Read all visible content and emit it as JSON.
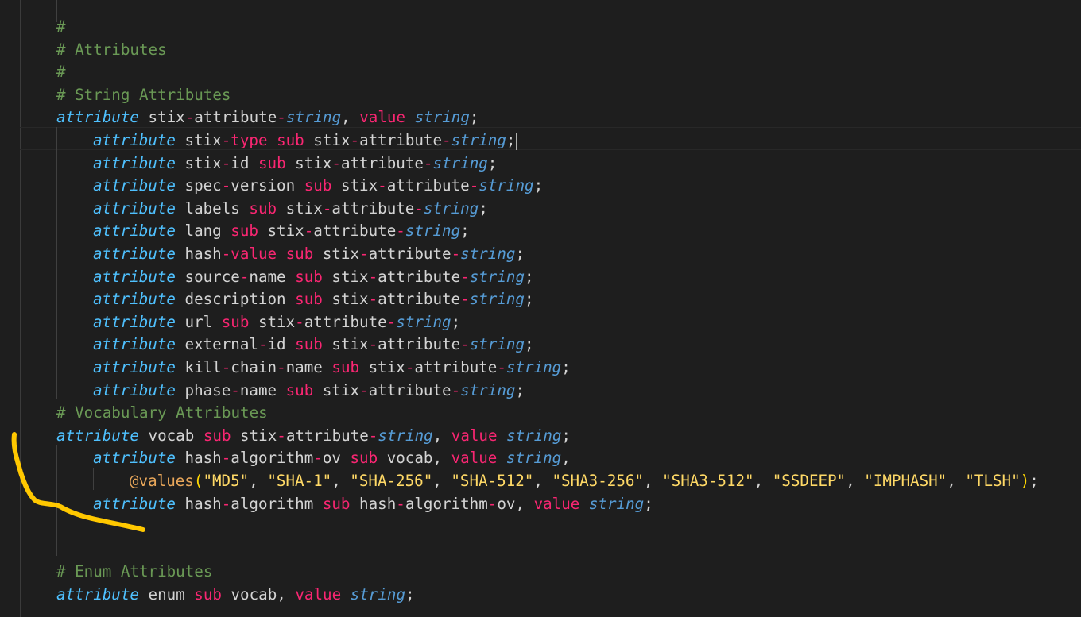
{
  "lines": [
    {
      "indent": 0,
      "tokens": [
        {
          "t": "#",
          "c": "cm"
        }
      ]
    },
    {
      "indent": 0,
      "tokens": [
        {
          "t": "# Attributes",
          "c": "cm"
        }
      ]
    },
    {
      "indent": 0,
      "tokens": [
        {
          "t": "#",
          "c": "cm"
        }
      ]
    },
    {
      "indent": 0,
      "tokens": [
        {
          "t": "# String Attributes",
          "c": "cm"
        }
      ]
    },
    {
      "indent": 0,
      "tokens": [
        {
          "t": "attribute",
          "c": "kw"
        },
        {
          "t": " stix",
          "c": "tx"
        },
        {
          "t": "-",
          "c": "pk"
        },
        {
          "t": "attribute",
          "c": "tx"
        },
        {
          "t": "-",
          "c": "pk"
        },
        {
          "t": "string",
          "c": "ty"
        },
        {
          "t": ", ",
          "c": "tx"
        },
        {
          "t": "value",
          "c": "pk"
        },
        {
          "t": " ",
          "c": "tx"
        },
        {
          "t": "string",
          "c": "ty"
        },
        {
          "t": ";",
          "c": "tx"
        }
      ]
    },
    {
      "indent": 1,
      "cursor": true,
      "tokens": [
        {
          "t": "attribute",
          "c": "kw"
        },
        {
          "t": " stix",
          "c": "tx"
        },
        {
          "t": "-",
          "c": "pk"
        },
        {
          "t": "type",
          "c": "pk"
        },
        {
          "t": " ",
          "c": "tx"
        },
        {
          "t": "sub",
          "c": "pk"
        },
        {
          "t": " stix",
          "c": "tx"
        },
        {
          "t": "-",
          "c": "pk"
        },
        {
          "t": "attribute",
          "c": "tx"
        },
        {
          "t": "-",
          "c": "pk"
        },
        {
          "t": "string",
          "c": "ty"
        },
        {
          "t": ";",
          "c": "tx"
        }
      ]
    },
    {
      "indent": 1,
      "tokens": [
        {
          "t": "attribute",
          "c": "kw"
        },
        {
          "t": " stix",
          "c": "tx"
        },
        {
          "t": "-",
          "c": "pk"
        },
        {
          "t": "id",
          "c": "tx"
        },
        {
          "t": " ",
          "c": "tx"
        },
        {
          "t": "sub",
          "c": "pk"
        },
        {
          "t": " stix",
          "c": "tx"
        },
        {
          "t": "-",
          "c": "pk"
        },
        {
          "t": "attribute",
          "c": "tx"
        },
        {
          "t": "-",
          "c": "pk"
        },
        {
          "t": "string",
          "c": "ty"
        },
        {
          "t": ";",
          "c": "tx"
        }
      ]
    },
    {
      "indent": 1,
      "tokens": [
        {
          "t": "attribute",
          "c": "kw"
        },
        {
          "t": " spec",
          "c": "tx"
        },
        {
          "t": "-",
          "c": "pk"
        },
        {
          "t": "version",
          "c": "tx"
        },
        {
          "t": " ",
          "c": "tx"
        },
        {
          "t": "sub",
          "c": "pk"
        },
        {
          "t": " stix",
          "c": "tx"
        },
        {
          "t": "-",
          "c": "pk"
        },
        {
          "t": "attribute",
          "c": "tx"
        },
        {
          "t": "-",
          "c": "pk"
        },
        {
          "t": "string",
          "c": "ty"
        },
        {
          "t": ";",
          "c": "tx"
        }
      ]
    },
    {
      "indent": 1,
      "tokens": [
        {
          "t": "attribute",
          "c": "kw"
        },
        {
          "t": " labels",
          "c": "tx"
        },
        {
          "t": " ",
          "c": "tx"
        },
        {
          "t": "sub",
          "c": "pk"
        },
        {
          "t": " stix",
          "c": "tx"
        },
        {
          "t": "-",
          "c": "pk"
        },
        {
          "t": "attribute",
          "c": "tx"
        },
        {
          "t": "-",
          "c": "pk"
        },
        {
          "t": "string",
          "c": "ty"
        },
        {
          "t": ";",
          "c": "tx"
        }
      ]
    },
    {
      "indent": 1,
      "tokens": [
        {
          "t": "attribute",
          "c": "kw"
        },
        {
          "t": " lang",
          "c": "tx"
        },
        {
          "t": " ",
          "c": "tx"
        },
        {
          "t": "sub",
          "c": "pk"
        },
        {
          "t": " stix",
          "c": "tx"
        },
        {
          "t": "-",
          "c": "pk"
        },
        {
          "t": "attribute",
          "c": "tx"
        },
        {
          "t": "-",
          "c": "pk"
        },
        {
          "t": "string",
          "c": "ty"
        },
        {
          "t": ";",
          "c": "tx"
        }
      ]
    },
    {
      "indent": 1,
      "tokens": [
        {
          "t": "attribute",
          "c": "kw"
        },
        {
          "t": " hash",
          "c": "tx"
        },
        {
          "t": "-",
          "c": "pk"
        },
        {
          "t": "value",
          "c": "pk"
        },
        {
          "t": " ",
          "c": "tx"
        },
        {
          "t": "sub",
          "c": "pk"
        },
        {
          "t": " stix",
          "c": "tx"
        },
        {
          "t": "-",
          "c": "pk"
        },
        {
          "t": "attribute",
          "c": "tx"
        },
        {
          "t": "-",
          "c": "pk"
        },
        {
          "t": "string",
          "c": "ty"
        },
        {
          "t": ";",
          "c": "tx"
        }
      ]
    },
    {
      "indent": 1,
      "tokens": [
        {
          "t": "attribute",
          "c": "kw"
        },
        {
          "t": " source",
          "c": "tx"
        },
        {
          "t": "-",
          "c": "pk"
        },
        {
          "t": "name",
          "c": "tx"
        },
        {
          "t": " ",
          "c": "tx"
        },
        {
          "t": "sub",
          "c": "pk"
        },
        {
          "t": " stix",
          "c": "tx"
        },
        {
          "t": "-",
          "c": "pk"
        },
        {
          "t": "attribute",
          "c": "tx"
        },
        {
          "t": "-",
          "c": "pk"
        },
        {
          "t": "string",
          "c": "ty"
        },
        {
          "t": ";",
          "c": "tx"
        }
      ]
    },
    {
      "indent": 1,
      "tokens": [
        {
          "t": "attribute",
          "c": "kw"
        },
        {
          "t": " description",
          "c": "tx"
        },
        {
          "t": " ",
          "c": "tx"
        },
        {
          "t": "sub",
          "c": "pk"
        },
        {
          "t": " stix",
          "c": "tx"
        },
        {
          "t": "-",
          "c": "pk"
        },
        {
          "t": "attribute",
          "c": "tx"
        },
        {
          "t": "-",
          "c": "pk"
        },
        {
          "t": "string",
          "c": "ty"
        },
        {
          "t": ";",
          "c": "tx"
        }
      ]
    },
    {
      "indent": 1,
      "tokens": [
        {
          "t": "attribute",
          "c": "kw"
        },
        {
          "t": " url",
          "c": "tx"
        },
        {
          "t": " ",
          "c": "tx"
        },
        {
          "t": "sub",
          "c": "pk"
        },
        {
          "t": " stix",
          "c": "tx"
        },
        {
          "t": "-",
          "c": "pk"
        },
        {
          "t": "attribute",
          "c": "tx"
        },
        {
          "t": "-",
          "c": "pk"
        },
        {
          "t": "string",
          "c": "ty"
        },
        {
          "t": ";",
          "c": "tx"
        }
      ]
    },
    {
      "indent": 1,
      "tokens": [
        {
          "t": "attribute",
          "c": "kw"
        },
        {
          "t": " external",
          "c": "tx"
        },
        {
          "t": "-",
          "c": "pk"
        },
        {
          "t": "id",
          "c": "tx"
        },
        {
          "t": " ",
          "c": "tx"
        },
        {
          "t": "sub",
          "c": "pk"
        },
        {
          "t": " stix",
          "c": "tx"
        },
        {
          "t": "-",
          "c": "pk"
        },
        {
          "t": "attribute",
          "c": "tx"
        },
        {
          "t": "-",
          "c": "pk"
        },
        {
          "t": "string",
          "c": "ty"
        },
        {
          "t": ";",
          "c": "tx"
        }
      ]
    },
    {
      "indent": 1,
      "tokens": [
        {
          "t": "attribute",
          "c": "kw"
        },
        {
          "t": " kill",
          "c": "tx"
        },
        {
          "t": "-",
          "c": "pk"
        },
        {
          "t": "chain",
          "c": "tx"
        },
        {
          "t": "-",
          "c": "pk"
        },
        {
          "t": "name",
          "c": "tx"
        },
        {
          "t": " ",
          "c": "tx"
        },
        {
          "t": "sub",
          "c": "pk"
        },
        {
          "t": " stix",
          "c": "tx"
        },
        {
          "t": "-",
          "c": "pk"
        },
        {
          "t": "attribute",
          "c": "tx"
        },
        {
          "t": "-",
          "c": "pk"
        },
        {
          "t": "string",
          "c": "ty"
        },
        {
          "t": ";",
          "c": "tx"
        }
      ]
    },
    {
      "indent": 1,
      "tokens": [
        {
          "t": "attribute",
          "c": "kw"
        },
        {
          "t": " phase",
          "c": "tx"
        },
        {
          "t": "-",
          "c": "pk"
        },
        {
          "t": "name",
          "c": "tx"
        },
        {
          "t": " ",
          "c": "tx"
        },
        {
          "t": "sub",
          "c": "pk"
        },
        {
          "t": " stix",
          "c": "tx"
        },
        {
          "t": "-",
          "c": "pk"
        },
        {
          "t": "attribute",
          "c": "tx"
        },
        {
          "t": "-",
          "c": "pk"
        },
        {
          "t": "string",
          "c": "ty"
        },
        {
          "t": ";",
          "c": "tx"
        }
      ]
    },
    {
      "indent": 0,
      "tokens": [
        {
          "t": "# Vocabulary Attributes",
          "c": "cm"
        }
      ]
    },
    {
      "indent": 0,
      "tokens": [
        {
          "t": "attribute",
          "c": "kw"
        },
        {
          "t": " vocab",
          "c": "tx"
        },
        {
          "t": " ",
          "c": "tx"
        },
        {
          "t": "sub",
          "c": "pk"
        },
        {
          "t": " stix",
          "c": "tx"
        },
        {
          "t": "-",
          "c": "pk"
        },
        {
          "t": "attribute",
          "c": "tx"
        },
        {
          "t": "-",
          "c": "pk"
        },
        {
          "t": "string",
          "c": "ty"
        },
        {
          "t": ", ",
          "c": "tx"
        },
        {
          "t": "value",
          "c": "pk"
        },
        {
          "t": " ",
          "c": "tx"
        },
        {
          "t": "string",
          "c": "ty"
        },
        {
          "t": ";",
          "c": "tx"
        }
      ]
    },
    {
      "indent": 1,
      "tokens": [
        {
          "t": "attribute",
          "c": "kw"
        },
        {
          "t": " hash",
          "c": "tx"
        },
        {
          "t": "-",
          "c": "pk"
        },
        {
          "t": "algorithm",
          "c": "tx"
        },
        {
          "t": "-",
          "c": "pk"
        },
        {
          "t": "ov",
          "c": "tx"
        },
        {
          "t": " ",
          "c": "tx"
        },
        {
          "t": "sub",
          "c": "pk"
        },
        {
          "t": " vocab, ",
          "c": "tx"
        },
        {
          "t": "value",
          "c": "pk"
        },
        {
          "t": " ",
          "c": "tx"
        },
        {
          "t": "string",
          "c": "ty"
        },
        {
          "t": ",",
          "c": "tx"
        }
      ]
    },
    {
      "indent": 2,
      "tokens": [
        {
          "t": "@values",
          "c": "an"
        },
        {
          "t": "(",
          "c": "br"
        },
        {
          "t": "\"MD5\"",
          "c": "st"
        },
        {
          "t": ", ",
          "c": "tx"
        },
        {
          "t": "\"SHA-1\"",
          "c": "st"
        },
        {
          "t": ", ",
          "c": "tx"
        },
        {
          "t": "\"SHA-256\"",
          "c": "st"
        },
        {
          "t": ", ",
          "c": "tx"
        },
        {
          "t": "\"SHA-512\"",
          "c": "st"
        },
        {
          "t": ", ",
          "c": "tx"
        },
        {
          "t": "\"SHA3-256\"",
          "c": "st"
        },
        {
          "t": ", ",
          "c": "tx"
        },
        {
          "t": "\"SHA3-512\"",
          "c": "st"
        },
        {
          "t": ", ",
          "c": "tx"
        },
        {
          "t": "\"SSDEEP\"",
          "c": "st"
        },
        {
          "t": ", ",
          "c": "tx"
        },
        {
          "t": "\"IMPHASH\"",
          "c": "st"
        },
        {
          "t": ", ",
          "c": "tx"
        },
        {
          "t": "\"TLSH\"",
          "c": "st"
        },
        {
          "t": ")",
          "c": "br"
        },
        {
          "t": ";",
          "c": "tx"
        }
      ]
    },
    {
      "indent": 1,
      "tokens": [
        {
          "t": "attribute",
          "c": "kw"
        },
        {
          "t": " hash",
          "c": "tx"
        },
        {
          "t": "-",
          "c": "pk"
        },
        {
          "t": "algorithm",
          "c": "tx"
        },
        {
          "t": " ",
          "c": "tx"
        },
        {
          "t": "sub",
          "c": "pk"
        },
        {
          "t": " hash",
          "c": "tx"
        },
        {
          "t": "-",
          "c": "pk"
        },
        {
          "t": "algorithm",
          "c": "tx"
        },
        {
          "t": "-",
          "c": "pk"
        },
        {
          "t": "ov, ",
          "c": "tx"
        },
        {
          "t": "value",
          "c": "pk"
        },
        {
          "t": " ",
          "c": "tx"
        },
        {
          "t": "string",
          "c": "ty"
        },
        {
          "t": ";",
          "c": "tx"
        }
      ]
    },
    {
      "indent": 0,
      "tokens": []
    },
    {
      "indent": 0,
      "tokens": []
    },
    {
      "indent": 0,
      "tokens": [
        {
          "t": "# Enum Attributes",
          "c": "cm"
        }
      ]
    },
    {
      "indent": 0,
      "tokens": [
        {
          "t": "attribute",
          "c": "kw"
        },
        {
          "t": " enum",
          "c": "tx"
        },
        {
          "t": " ",
          "c": "tx"
        },
        {
          "t": "sub",
          "c": "pk"
        },
        {
          "t": " vocab, ",
          "c": "tx"
        },
        {
          "t": "value",
          "c": "pk"
        },
        {
          "t": " ",
          "c": "tx"
        },
        {
          "t": "string",
          "c": "ty"
        },
        {
          "t": ";",
          "c": "tx"
        }
      ]
    }
  ],
  "annotation": {
    "color": "#ffc800"
  }
}
